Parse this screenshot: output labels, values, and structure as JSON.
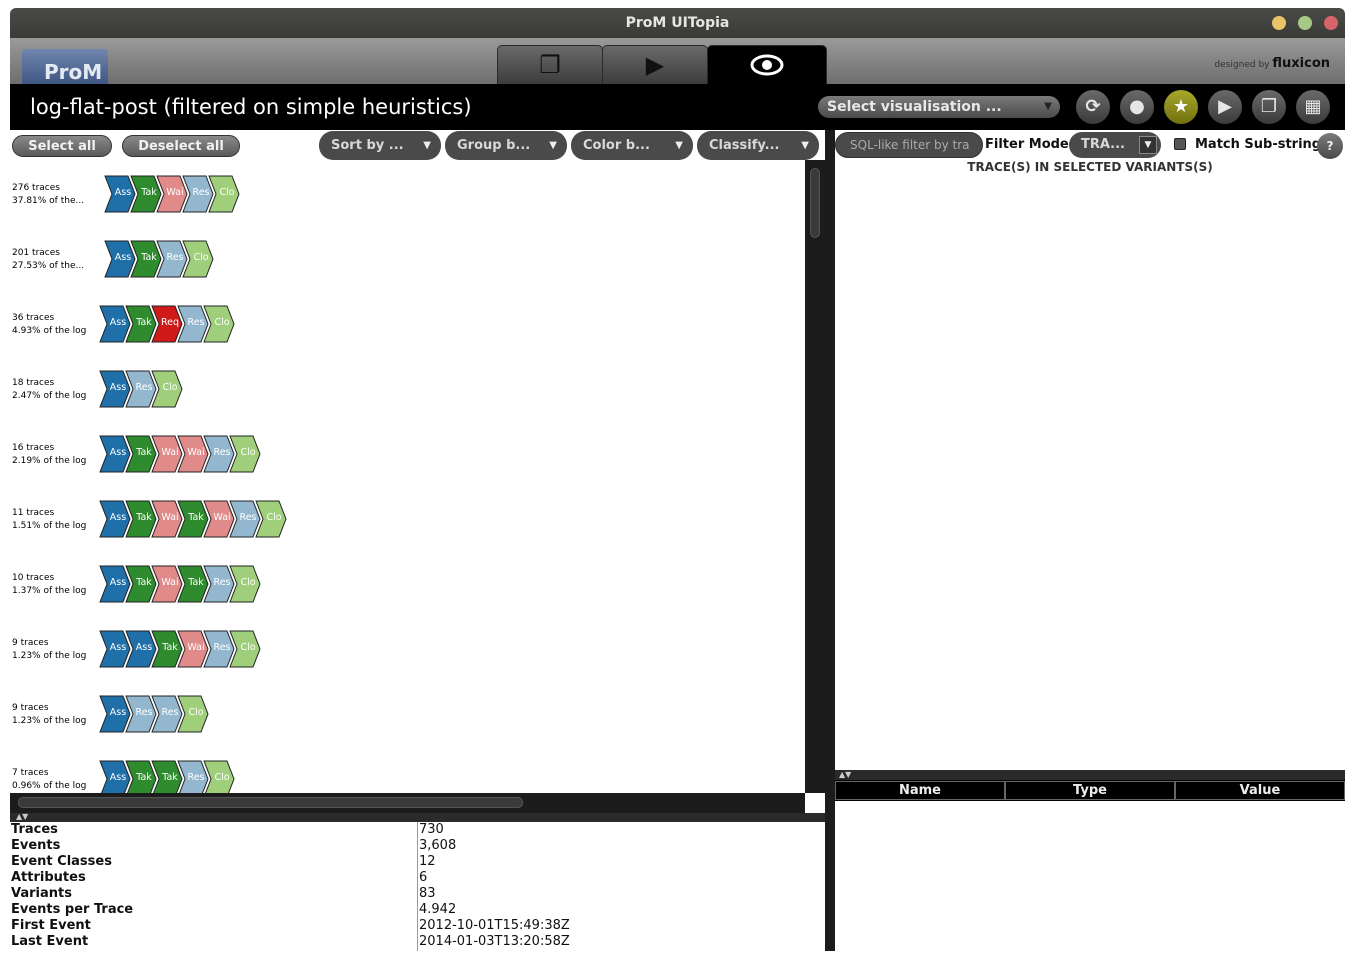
{
  "window": {
    "title": "ProM UITopia"
  },
  "app": {
    "logo": "ProM",
    "designed_by": "designed by",
    "brand": "fluxicon",
    "mode_tabs": [
      {
        "name": "workspace",
        "icon": "❐"
      },
      {
        "name": "actions",
        "icon": "▶"
      },
      {
        "name": "views",
        "icon": "👁"
      }
    ]
  },
  "header": {
    "title": "log-flat-post (filtered on simple heuristics)",
    "visualisation_select": "Select visualisation ...",
    "buttons": [
      "refresh-icon",
      "drop-icon",
      "star-icon",
      "play-icon",
      "copy-icon",
      "grid-icon"
    ]
  },
  "toolbar": {
    "select_all": "Select all",
    "deselect_all": "Deselect all",
    "sort_by": "Sort by ...",
    "group_by": "Group b...",
    "color_by": "Color b...",
    "classify": "Classify..."
  },
  "variants": [
    {
      "count": "276 traces",
      "pct": "37.81% of the...",
      "events": [
        "Ass",
        "Tak",
        "Wai",
        "Res",
        "Clo"
      ]
    },
    {
      "count": "201 traces",
      "pct": "27.53% of the...",
      "events": [
        "Ass",
        "Tak",
        "Res",
        "Clo"
      ]
    },
    {
      "count": "36 traces",
      "pct": "4.93% of the log",
      "events": [
        "Ass",
        "Tak",
        "Req",
        "Res",
        "Clo"
      ]
    },
    {
      "count": "18 traces",
      "pct": "2.47% of the log",
      "events": [
        "Ass",
        "Res",
        "Clo"
      ]
    },
    {
      "count": "16 traces",
      "pct": "2.19% of the log",
      "events": [
        "Ass",
        "Tak",
        "Wai",
        "Wai",
        "Res",
        "Clo"
      ]
    },
    {
      "count": "11 traces",
      "pct": "1.51% of the log",
      "events": [
        "Ass",
        "Tak",
        "Wai",
        "Tak",
        "Wai",
        "Res",
        "Clo"
      ]
    },
    {
      "count": "10 traces",
      "pct": "1.37% of the log",
      "events": [
        "Ass",
        "Tak",
        "Wai",
        "Tak",
        "Res",
        "Clo"
      ]
    },
    {
      "count": "9 traces",
      "pct": "1.23% of the log",
      "events": [
        "Ass",
        "Ass",
        "Tak",
        "Wai",
        "Res",
        "Clo"
      ]
    },
    {
      "count": "9 traces",
      "pct": "1.23% of the log",
      "events": [
        "Ass",
        "Res",
        "Res",
        "Clo"
      ]
    },
    {
      "count": "7 traces",
      "pct": "0.96% of the log",
      "events": [
        "Ass",
        "Tak",
        "Tak",
        "Res",
        "Clo"
      ]
    }
  ],
  "event_colors": {
    "Ass": "#1f6fa8",
    "Tak": "#2e8b2e",
    "Wai": "#e08a8a",
    "Res": "#92b7cf",
    "Clo": "#9fcf7a",
    "Req": "#d01a1a"
  },
  "summary": [
    {
      "key": "Traces",
      "value": "730"
    },
    {
      "key": "Events",
      "value": "3,608"
    },
    {
      "key": "Event Classes",
      "value": "12"
    },
    {
      "key": "Attributes",
      "value": "6"
    },
    {
      "key": "Variants",
      "value": "83"
    },
    {
      "key": "Events per Trace",
      "value": "4.942"
    },
    {
      "key": "First Event",
      "value": "2012-10-01T15:49:38Z"
    },
    {
      "key": "Last Event",
      "value": "2014-01-03T13:20:58Z"
    }
  ],
  "filter": {
    "placeholder": "SQL-like filter by tra",
    "mode_label": "Filter Mode",
    "mode_value": "TRA...",
    "match_substring": "Match Sub-string",
    "help": "?"
  },
  "traces_heading": "TRACE(S) IN SELECTED VARIANTS(S)",
  "attributes_table": {
    "columns": [
      "Name",
      "Type",
      "Value"
    ]
  }
}
